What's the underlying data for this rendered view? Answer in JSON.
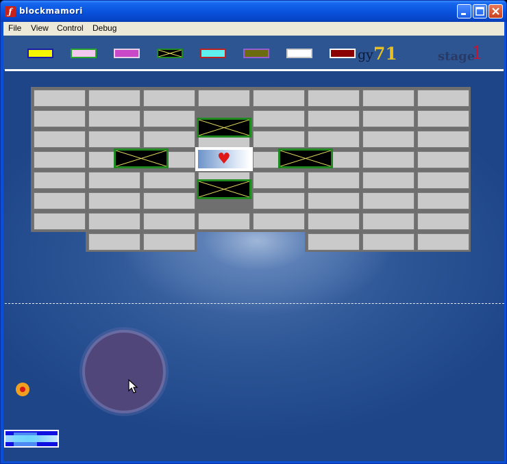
{
  "window": {
    "title": "blockmamori"
  },
  "menu": {
    "items": [
      "File",
      "View",
      "Control",
      "Debug"
    ]
  },
  "hud": {
    "legend": [
      {
        "fill": "#f5f500",
        "border": "#1a1aa8"
      },
      {
        "fill": "#f5c8f0",
        "border": "#2aa82a"
      },
      {
        "fill": "#c848c8",
        "border": "#e8d0e8"
      },
      {
        "fill": "crossed",
        "border": "#1f8a1f"
      },
      {
        "fill": "#60f0f0",
        "border": "#c02020"
      },
      {
        "fill": "#6b6b10",
        "border": "#9a5ad0"
      },
      {
        "fill": "#ffffff",
        "border": "#c8c8c8"
      },
      {
        "fill": "#8a0000",
        "border": "#ffffff"
      }
    ],
    "energy_label": "gy",
    "energy_value": "71",
    "stage_label": "stage",
    "stage_value": "1"
  },
  "icons": {
    "app": "app-icon",
    "minimize": "minimize-icon",
    "maximize": "maximize-icon",
    "close": "close-icon",
    "heart": "♥",
    "cursor": "mouse-pointer-icon"
  },
  "colors": {
    "brick": "#cacaca",
    "crossed_brick_border": "#1f8a1f",
    "crossed_brick_x": "#e8e060"
  }
}
